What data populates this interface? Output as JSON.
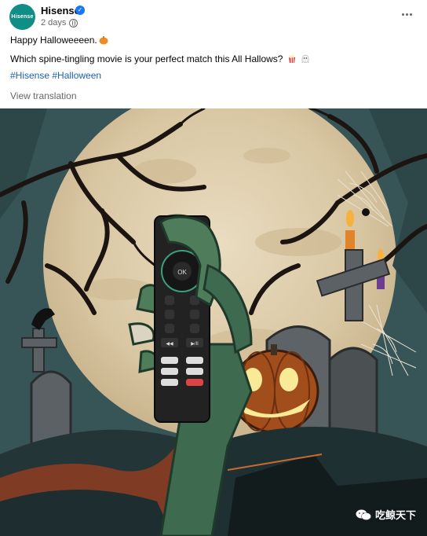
{
  "post": {
    "page_name": "Hisense",
    "avatar_text": "Hisense",
    "timestamp": "2 days",
    "line1": "Happy Halloweeeen.",
    "line2": "Which spine-tingling movie is your perfect match this All Hallows?",
    "hashtags": [
      "#Hisense",
      "#Halloween"
    ],
    "view_translation": "View translation"
  },
  "image": {
    "remote_labels": {
      "ok": "OK",
      "buttons": [
        "◀◀",
        "▶/II"
      ]
    },
    "watermark": "吃鲸天下"
  },
  "colors": {
    "brand": "#0f8e86",
    "link": "#1d5fb8",
    "verified": "#1877f2"
  }
}
